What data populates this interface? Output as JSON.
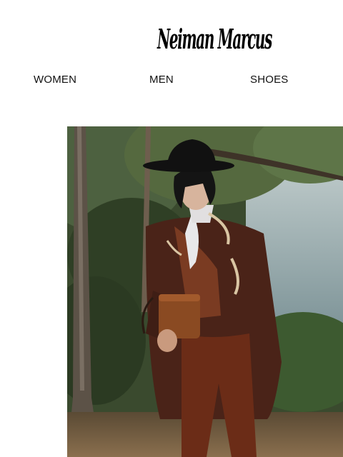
{
  "brand": {
    "logo_text": "Neiman Marcus"
  },
  "nav": {
    "items": [
      {
        "label": "WOMEN"
      },
      {
        "label": "MEN"
      },
      {
        "label": "SHOES"
      }
    ]
  },
  "hero": {
    "image_subject": "hero-photo",
    "colors": {
      "coat": "#4a2318",
      "trousers": "#6b2c17",
      "bag": "#8a4a22",
      "hat": "#111111",
      "forest": "#3b4a2c",
      "water": "#9fb2b7"
    }
  }
}
